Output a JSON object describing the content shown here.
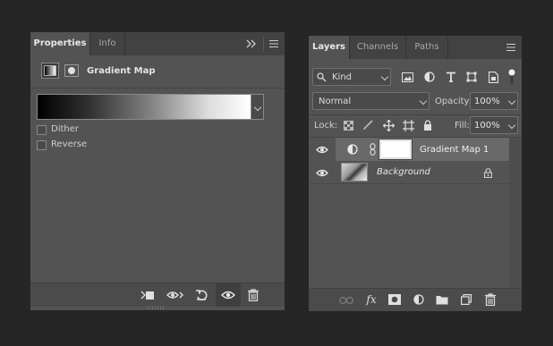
{
  "properties_panel": {
    "tabs": [
      "Properties",
      "Info"
    ],
    "title": "Gradient Map",
    "dither_label": "Dither",
    "reverse_label": "Reverse",
    "dither_checked": false,
    "reverse_checked": false,
    "footer_icons": [
      "clip-to-layer-icon",
      "view-previous-state-icon",
      "reset-icon",
      "visibility-icon",
      "trash-icon"
    ]
  },
  "layers_panel": {
    "tabs": [
      "Layers",
      "Channels",
      "Paths"
    ],
    "filter_kind": "Kind",
    "filter_icons": [
      "image-filter-icon",
      "adjustment-filter-icon",
      "type-filter-icon",
      "shape-filter-icon",
      "smart-object-filter-icon"
    ],
    "blend_mode": "Normal",
    "opacity_label": "Opacity:",
    "opacity_value": "100%",
    "lock_label": "Lock:",
    "lock_icons": [
      "lock-transparency-icon",
      "lock-image-icon",
      "lock-position-icon",
      "lock-artboard-icon",
      "lock-all-icon"
    ],
    "fill_label": "Fill:",
    "fill_value": "100%",
    "layers": [
      {
        "name": "Gradient Map 1",
        "visible": true,
        "selected": true,
        "italic": false
      },
      {
        "name": "Background",
        "visible": true,
        "selected": false,
        "italic": true,
        "locked": true
      }
    ],
    "footer_icons": [
      "link-layers-icon",
      "fx-icon",
      "layer-mask-icon",
      "adjustment-layer-icon",
      "group-folder-icon",
      "new-layer-icon",
      "trash-icon"
    ],
    "footer_fx_text": "fx"
  },
  "colors": {
    "background": "#262626",
    "panel": "#535353",
    "tabbar": "#424242",
    "selected_row": "#696969",
    "gradient_start": "#000000",
    "gradient_end": "#ffffff"
  }
}
